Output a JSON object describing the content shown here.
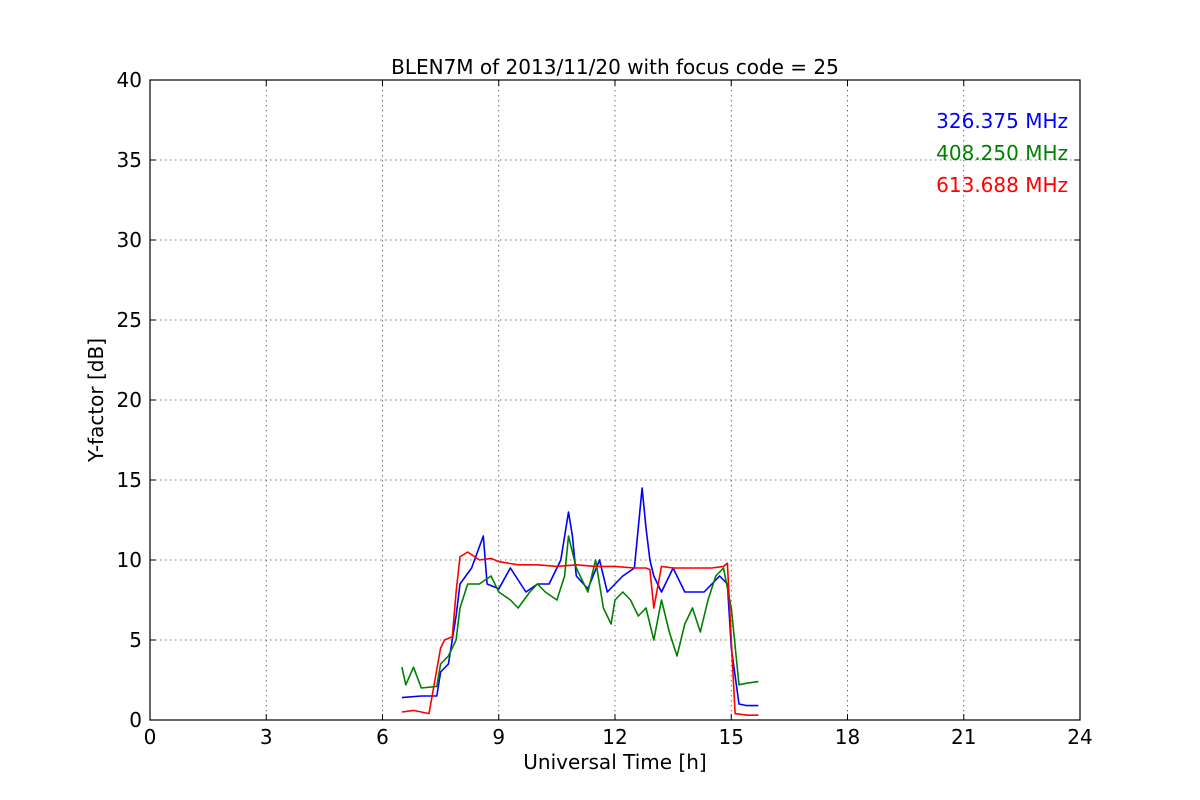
{
  "chart_data": {
    "type": "line",
    "title": "BLEN7M of 2013/11/20 with focus code = 25",
    "xlabel": "Universal Time [h]",
    "ylabel": "Y-factor [dB]",
    "xlim": [
      0,
      24
    ],
    "ylim": [
      0,
      40
    ],
    "xticks": [
      0,
      3,
      6,
      9,
      12,
      15,
      18,
      21,
      24
    ],
    "yticks": [
      0,
      5,
      10,
      15,
      20,
      25,
      30,
      35,
      40
    ],
    "grid": true,
    "legend_position": "top-right",
    "series": [
      {
        "name": "326.375 MHz",
        "color": "#0000ff",
        "x": [
          6.5,
          7.0,
          7.4,
          7.5,
          7.7,
          7.9,
          8.0,
          8.3,
          8.6,
          8.7,
          9.0,
          9.3,
          9.7,
          10.0,
          10.3,
          10.6,
          10.8,
          10.9,
          11.0,
          11.3,
          11.6,
          11.8,
          12.0,
          12.2,
          12.5,
          12.7,
          12.8,
          12.9,
          13.0,
          13.2,
          13.5,
          13.8,
          14.0,
          14.3,
          14.5,
          14.7,
          14.9,
          15.0,
          15.2,
          15.4,
          15.7
        ],
        "y": [
          1.4,
          1.5,
          1.5,
          3.0,
          3.5,
          6.5,
          8.5,
          9.5,
          11.5,
          8.5,
          8.2,
          9.5,
          8.0,
          8.5,
          8.5,
          10.0,
          13.0,
          11.5,
          9.0,
          8.2,
          10.0,
          8.0,
          8.5,
          9.0,
          9.5,
          14.5,
          12.0,
          10.0,
          9.0,
          8.0,
          9.5,
          8.0,
          8.0,
          8.0,
          8.5,
          9.0,
          8.5,
          4.5,
          1.0,
          0.9,
          0.9
        ]
      },
      {
        "name": "408.250 MHz",
        "color": "#008000",
        "x": [
          6.5,
          6.6,
          6.8,
          7.0,
          7.4,
          7.5,
          7.7,
          7.9,
          8.0,
          8.2,
          8.5,
          8.8,
          9.0,
          9.3,
          9.5,
          9.8,
          10.0,
          10.2,
          10.5,
          10.7,
          10.8,
          11.0,
          11.3,
          11.5,
          11.7,
          11.9,
          12.0,
          12.2,
          12.4,
          12.6,
          12.8,
          13.0,
          13.2,
          13.4,
          13.6,
          13.8,
          14.0,
          14.2,
          14.4,
          14.6,
          14.8,
          15.0,
          15.2,
          15.4,
          15.7
        ],
        "y": [
          3.3,
          2.2,
          3.3,
          2.0,
          2.1,
          3.5,
          4.0,
          5.0,
          7.0,
          8.5,
          8.5,
          9.0,
          8.0,
          7.5,
          7.0,
          8.0,
          8.5,
          8.0,
          7.5,
          9.0,
          11.5,
          9.5,
          8.0,
          10.0,
          7.0,
          6.0,
          7.5,
          8.0,
          7.5,
          6.5,
          7.0,
          5.0,
          7.5,
          5.5,
          4.0,
          6.0,
          7.0,
          5.5,
          7.5,
          9.0,
          9.5,
          7.0,
          2.2,
          2.3,
          2.4
        ]
      },
      {
        "name": "613.688 MHz",
        "color": "#ff0000",
        "x": [
          6.5,
          6.8,
          7.0,
          7.2,
          7.5,
          7.6,
          7.8,
          7.9,
          8.0,
          8.2,
          8.5,
          8.8,
          9.0,
          9.5,
          10.0,
          10.5,
          11.0,
          11.5,
          12.0,
          12.5,
          12.8,
          12.9,
          13.0,
          13.2,
          13.5,
          14.0,
          14.5,
          14.8,
          14.9,
          15.0,
          15.1,
          15.4,
          15.7
        ],
        "y": [
          0.5,
          0.6,
          0.5,
          0.4,
          4.5,
          5.0,
          5.2,
          8.0,
          10.2,
          10.5,
          10.0,
          10.1,
          9.9,
          9.7,
          9.7,
          9.6,
          9.7,
          9.6,
          9.6,
          9.5,
          9.5,
          9.4,
          7.0,
          9.6,
          9.5,
          9.5,
          9.5,
          9.6,
          9.8,
          5.0,
          0.4,
          0.3,
          0.3
        ]
      }
    ]
  }
}
